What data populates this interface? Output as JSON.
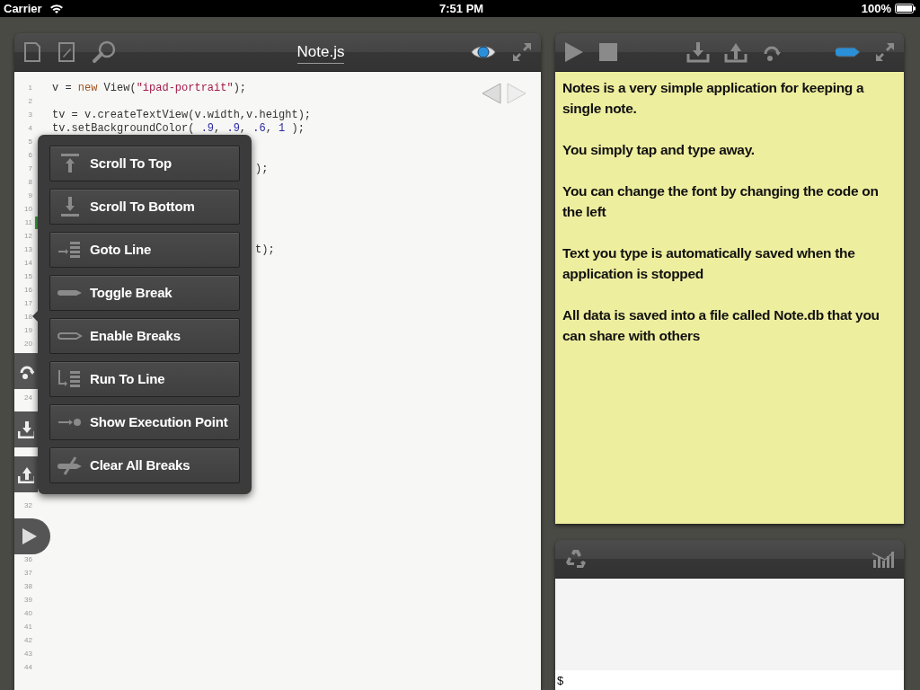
{
  "status_bar": {
    "carrier": "Carrier",
    "time": "7:51 PM",
    "battery": "100%"
  },
  "editor": {
    "title": "Note.js",
    "lines": [
      {
        "number": "1",
        "marked": false,
        "code": [
          {
            "text": "v = ",
            "kind": "plain"
          },
          {
            "text": "new",
            "kind": "keyword"
          },
          {
            "text": " View(",
            "kind": "plain"
          },
          {
            "text": "\"ipad-portrait\"",
            "kind": "string"
          },
          {
            "text": ");",
            "kind": "plain"
          }
        ]
      },
      {
        "number": "2",
        "marked": false
      },
      {
        "number": "3",
        "marked": false,
        "code": [
          {
            "text": "tv = v.createTextView(v.width,v.height);",
            "kind": "plain"
          }
        ]
      },
      {
        "number": "4",
        "marked": false,
        "code": [
          {
            "text": "tv.setBackgroundColor( ",
            "kind": "plain"
          },
          {
            "text": ".9",
            "kind": "number"
          },
          {
            "text": ", ",
            "kind": "plain"
          },
          {
            "text": ".9",
            "kind": "number"
          },
          {
            "text": ", ",
            "kind": "plain"
          },
          {
            "text": ".6",
            "kind": "number"
          },
          {
            "text": ", ",
            "kind": "plain"
          },
          {
            "text": "1",
            "kind": "number"
          },
          {
            "text": " );",
            "kind": "plain"
          }
        ]
      },
      {
        "number": "5",
        "marked": false
      },
      {
        "number": "6",
        "marked": false
      },
      {
        "number": "7",
        "marked": false,
        "code": [
          {
            "text": ");",
            "kind": "tail"
          }
        ]
      },
      {
        "number": "8",
        "marked": false
      },
      {
        "number": "9",
        "marked": false
      },
      {
        "number": "10",
        "marked": false
      },
      {
        "number": "11",
        "marked": true
      },
      {
        "number": "12",
        "marked": false
      },
      {
        "number": "13",
        "marked": false,
        "code": [
          {
            "text": "t);",
            "kind": "tail"
          }
        ]
      },
      {
        "number": "14",
        "marked": false
      },
      {
        "number": "15",
        "marked": false
      },
      {
        "number": "16",
        "marked": false
      },
      {
        "number": "17",
        "marked": false
      },
      {
        "number": "18",
        "marked": false
      },
      {
        "number": "19",
        "marked": false
      },
      {
        "number": "20",
        "marked": false
      },
      {
        "number": "24",
        "marked": false
      },
      {
        "number": "32",
        "marked": false
      },
      {
        "number": "36",
        "marked": false
      },
      {
        "number": "37",
        "marked": false
      },
      {
        "number": "38",
        "marked": false
      },
      {
        "number": "39",
        "marked": false
      },
      {
        "number": "40",
        "marked": false
      },
      {
        "number": "41",
        "marked": false
      },
      {
        "number": "42",
        "marked": false
      },
      {
        "number": "43",
        "marked": false
      },
      {
        "number": "44",
        "marked": false
      }
    ]
  },
  "menu": {
    "items": [
      {
        "label": "Scroll To Top"
      },
      {
        "label": "Scroll To Bottom"
      },
      {
        "label": "Goto Line"
      },
      {
        "label": "Toggle Break"
      },
      {
        "label": "Enable Breaks"
      },
      {
        "label": "Run To Line"
      },
      {
        "label": "Show Execution Point"
      },
      {
        "label": "Clear All Breaks"
      }
    ]
  },
  "note": {
    "paragraphs": [
      "Notes is a very simple application for keeping a single note.",
      "You simply tap and type away.",
      "You can change the font by changing the code on the left",
      "Text you type is automatically saved when the application is stopped",
      "All data is saved into a file called Note.db that you can share with others"
    ]
  },
  "console": {
    "prompt": "$"
  }
}
